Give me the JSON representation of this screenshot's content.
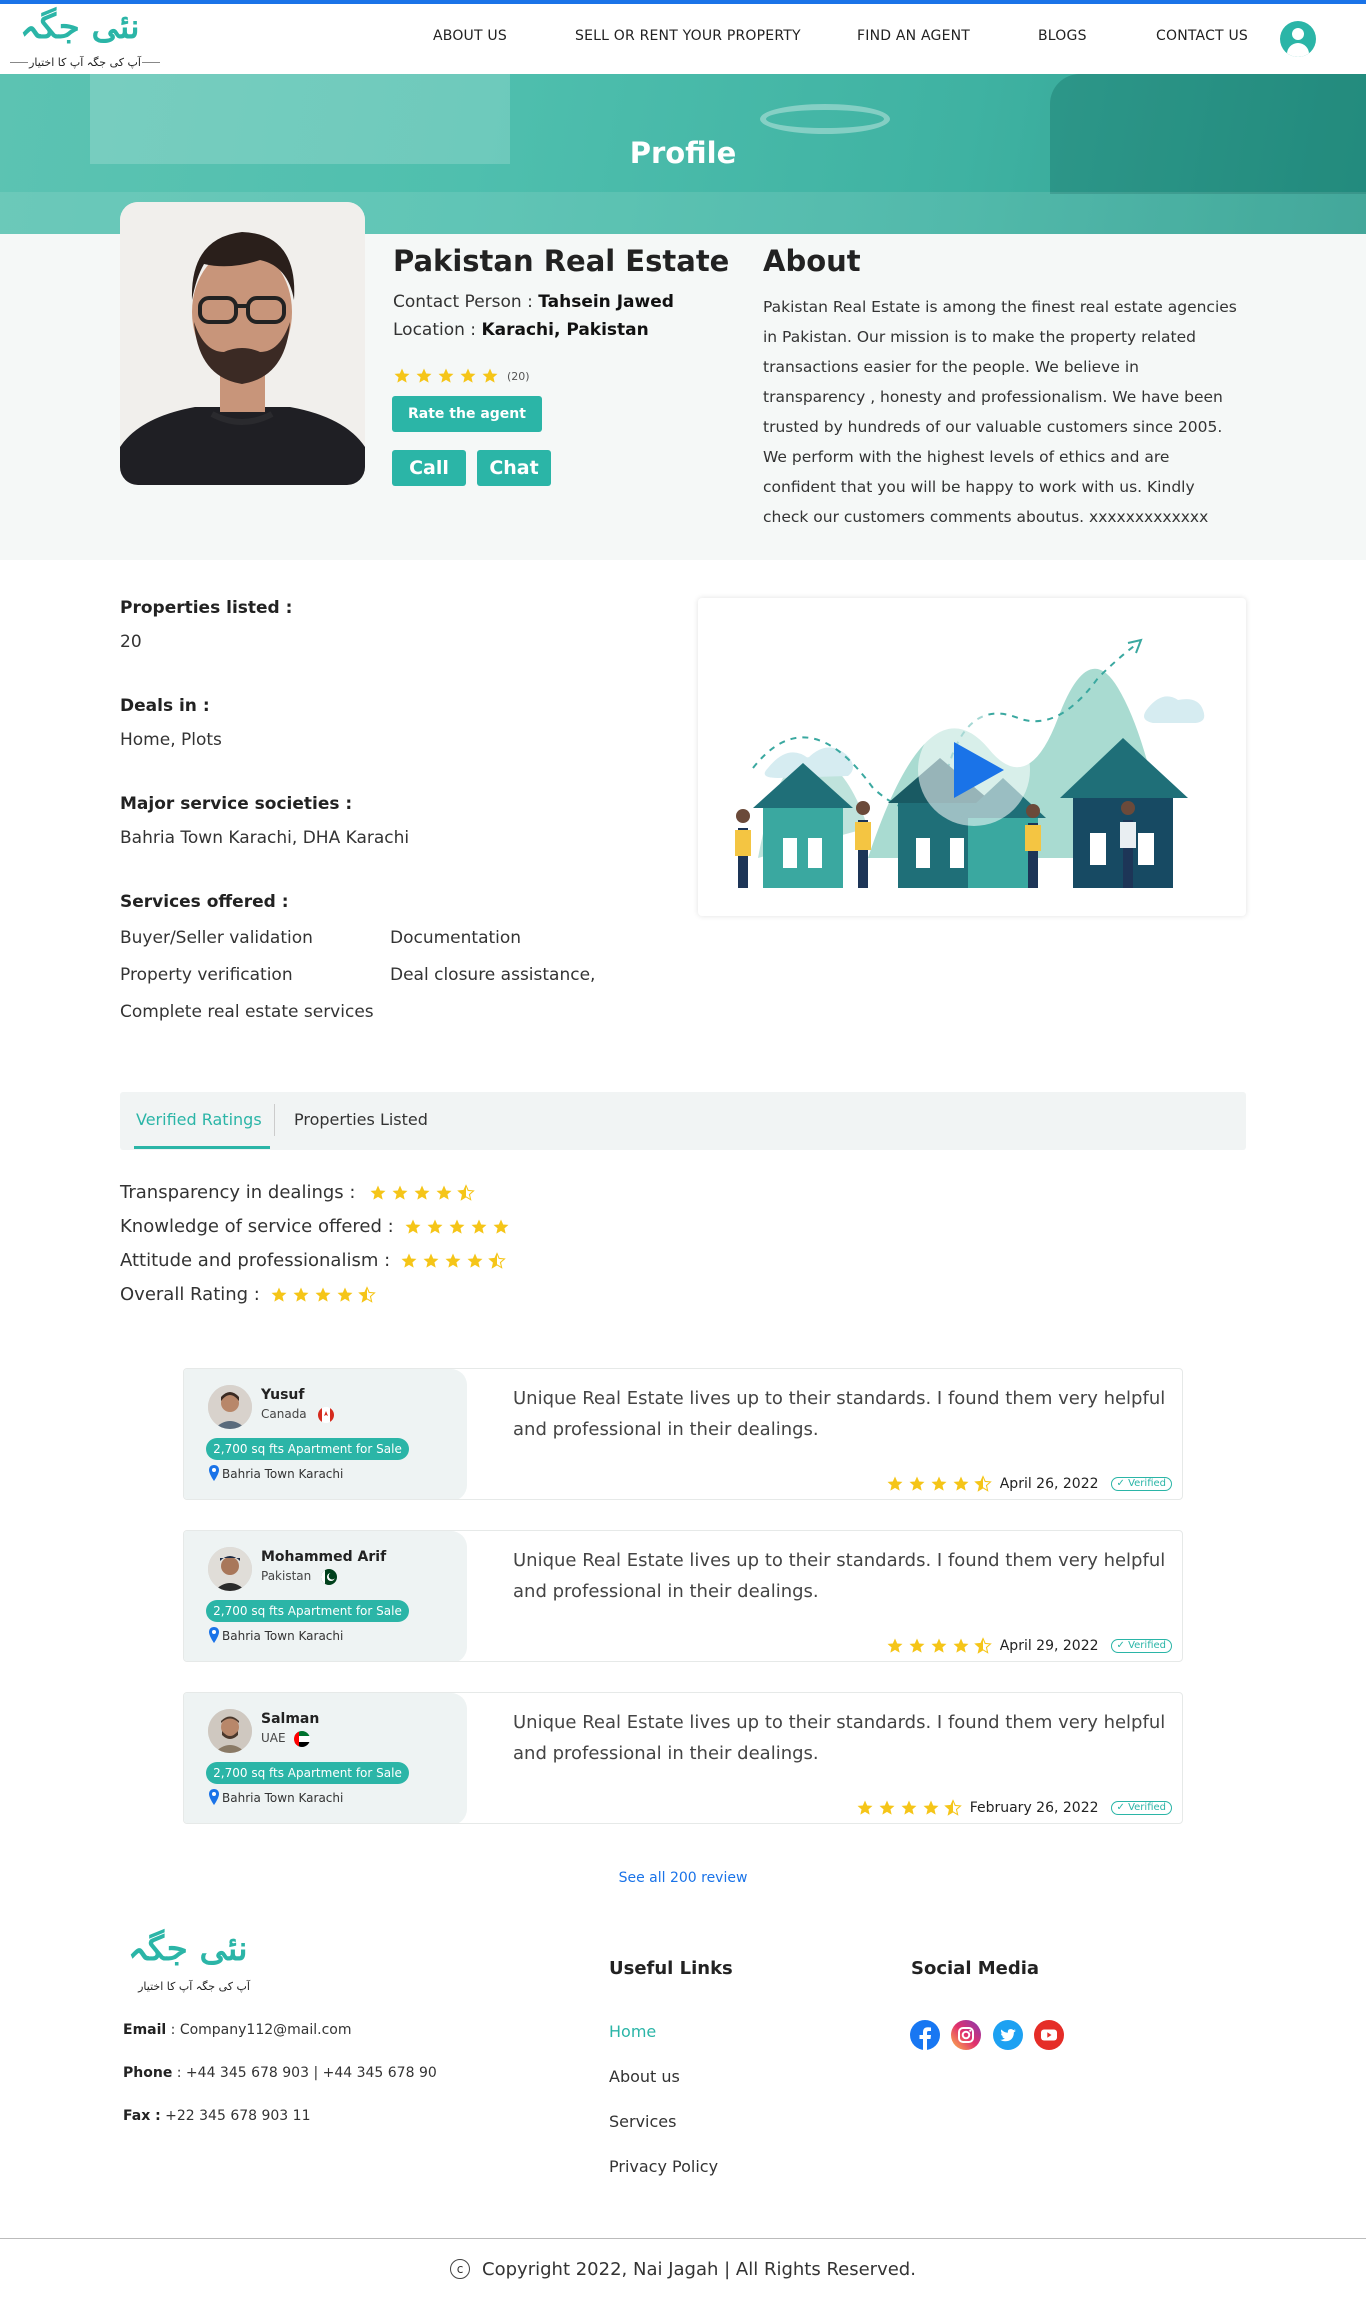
{
  "header": {
    "logo_text": "نئی جگہ",
    "logo_tagline": "آپ کی جگہ آپ کا اختیار",
    "nav": [
      "ABOUT US",
      "SELL OR RENT YOUR PROPERTY",
      "FIND AN AGENT",
      "BLOGS",
      "CONTACT US"
    ],
    "user_icon": "user-circle-icon"
  },
  "hero": {
    "title": "Profile"
  },
  "profile": {
    "agency_name": "Pakistan Real Estate",
    "contact_label": "Contact Person : ",
    "contact_name": "Tahsein Jawed",
    "location_label": "Location : ",
    "location": "Karachi, Pakistan",
    "rating_stars": 5,
    "rating_count": "(20)",
    "rate_button": "Rate the agent",
    "call_button": "Call",
    "chat_button": "Chat"
  },
  "about": {
    "title": "About",
    "text": "Pakistan Real Estate is among the finest real estate agencies in Pakistan. Our mission is to make the property related transactions easier for the people. We believe in transparency , honesty and professionalism. We have been trusted by hundreds of our valuable customers since 2005. We perform with the highest levels of ethics and are confident that you will be happy to work with us. Kindly check our customers comments aboutus.  xxxxxxxxxxxxx"
  },
  "details": {
    "properties_label": "Properties listed :",
    "properties_value": "20",
    "deals_label": "Deals in :",
    "deals_value": "Home, Plots",
    "societies_label": "Major service societies :",
    "societies_value": "Bahria Town Karachi, DHA Karachi",
    "services_label": "Services offered :",
    "services": [
      "Buyer/Seller validation",
      "Documentation",
      "Property verification",
      "Deal closure assistance,",
      "Complete real estate services"
    ]
  },
  "video": {
    "play_icon": "play-icon"
  },
  "tabs": {
    "active": "Verified Ratings",
    "other": "Properties Listed"
  },
  "ratings": [
    {
      "label": "Transparency in dealings  :",
      "stars": 4.5
    },
    {
      "label": "Knowledge of service offered :",
      "stars": 5
    },
    {
      "label": "Attitude and professionalism :",
      "stars": 4.5
    },
    {
      "label": "Overall Rating :",
      "stars": 4.5
    }
  ],
  "reviews": [
    {
      "name": "Yusuf",
      "country": "Canada",
      "property": "2,700 sq fts Apartment for Sale",
      "location": "Bahria Town Karachi",
      "text": "Unique Real Estate lives up to their standards. I found them very helpful and professional in their dealings.",
      "stars": 4.5,
      "date": "April 26, 2022",
      "badge": "Verified"
    },
    {
      "name": "Mohammed Arif",
      "country": "Pakistan",
      "property": "2,700 sq fts Apartment for Sale",
      "location": "Bahria Town Karachi",
      "text": "Unique Real Estate lives up to their standards. I found them very helpful and professional in their dealings.",
      "stars": 4.5,
      "date": "April 29, 2022",
      "badge": "Verified"
    },
    {
      "name": "Salman",
      "country": "UAE",
      "property": "2,700 sq fts Apartment for Sale",
      "location": "Bahria Town Karachi",
      "text": "Unique Real Estate lives up to their standards. I found them very helpful and professional in their dealings.",
      "stars": 4.5,
      "date": "February 26, 2022",
      "badge": "Verified"
    }
  ],
  "see_all": "See all 200 review",
  "footer": {
    "email_label": "Email",
    "email": " : Company112@mail.com",
    "phone_label": "Phone",
    "phone": " : +44 345 678 903  | +44 345 678 90",
    "fax_label": "Fax :",
    "fax": " +22 345 678 903 11",
    "links_title": "Useful Links",
    "links": [
      "Home",
      "About us",
      "Services",
      "Privacy Policy"
    ],
    "social_title": "Social Media",
    "social": [
      "facebook-icon",
      "instagram-icon",
      "twitter-icon",
      "youtube-icon"
    ],
    "copyright_symbol": "c",
    "copyright": "Copyright  2022, Nai Jagah |  All Rights Reserved."
  },
  "colors": {
    "accent": "#2bb5a7",
    "star": "#f5c518",
    "link": "#1a73e8"
  }
}
